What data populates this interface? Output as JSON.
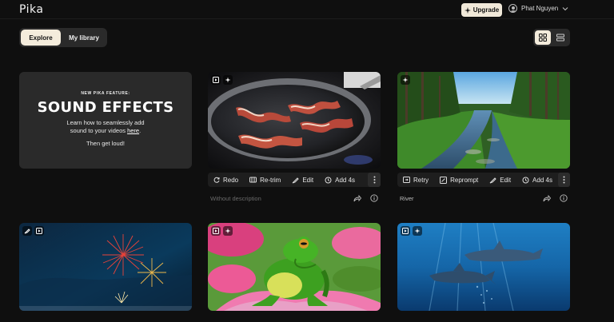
{
  "header": {
    "logo": "Pika",
    "upgrade_label": "Upgrade",
    "user_name": "Phat Nguyen"
  },
  "tabs": [
    {
      "label": "Explore",
      "active": true
    },
    {
      "label": "My library",
      "active": false
    }
  ],
  "view": {
    "grid_active": true
  },
  "promo": {
    "kicker": "NEW PIKA FEATURE:",
    "title": "SOUND EFFECTS",
    "body_line1": "Learn how to seamlessly add",
    "body_line2_prefix": "sound to your videos ",
    "body_link": "here",
    "body_line2_suffix": ".",
    "cta": "Then get loud!"
  },
  "cards": [
    {
      "scene": "bacon-in-pan",
      "actions": [
        "Redo",
        "Re-trim",
        "Edit",
        "Add 4s"
      ],
      "description": "Without description",
      "description_is_placeholder": true
    },
    {
      "scene": "river-forest",
      "actions": [
        "Retry",
        "Reprompt",
        "Edit",
        "Add 4s"
      ],
      "description": "River",
      "description_is_placeholder": false
    },
    {
      "scene": "fireworks"
    },
    {
      "scene": "frog-on-flower"
    },
    {
      "scene": "dolphins-underwater"
    }
  ],
  "colors": {
    "background": "#0f0f0f",
    "accent_cream": "#f4ecdc",
    "panel": "#2a2a2a"
  }
}
